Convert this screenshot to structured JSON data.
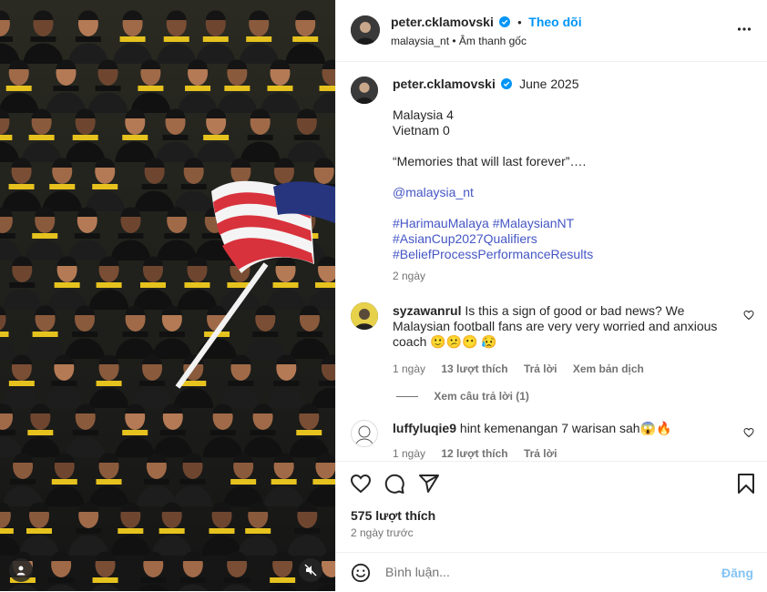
{
  "post": {
    "username": "peter.cklamovski",
    "follow_label": "Theo dõi",
    "collab": "malaysia_nt",
    "audio": "Âm thanh gốc",
    "separator": "•"
  },
  "caption": {
    "username": "peter.cklamovski",
    "date": "June 2025",
    "lines": [
      "Malaysia 4",
      "Vietnam 0"
    ],
    "quote": "“Memories that will last forever”….",
    "mention": "@malaysia_nt",
    "hashtags": [
      "#HarimauMalaya #MalaysianNT",
      "#AsianCup2027Qualifiers",
      "#BeliefProcessPerformanceResults"
    ],
    "time": "2 ngày"
  },
  "comments": [
    {
      "username": "syzawanrul",
      "text": "Is this a sign of good or bad news? We Malaysian football fans are very very worried and anxious coach 🙂😕😶 😥",
      "time": "1 ngày",
      "likes": "13 lượt thích",
      "reply": "Trả lời",
      "translate": "Xem bản dịch",
      "view_replies": "Xem câu trả lời (1)"
    },
    {
      "username": "luffyluqie9",
      "text": "hint kemenangan 7 warisan sah😱🔥",
      "time": "1 ngày",
      "likes": "12 lượt thích",
      "reply": "Trả lời"
    }
  ],
  "likes_count": "575 lượt thích",
  "posted": "2 ngày trước",
  "comment_box": {
    "placeholder": "Bình luận...",
    "post_label": "Đăng"
  },
  "colors": {
    "link": "#4556c4",
    "follow": "#0095f6",
    "secondary": "#737373",
    "verified": "#0095f6"
  },
  "icons": [
    "more-icon",
    "heart-icon",
    "comment-icon",
    "share-icon",
    "bookmark-icon",
    "emoji-icon",
    "user-tag-icon",
    "mute-icon",
    "verified-icon"
  ]
}
